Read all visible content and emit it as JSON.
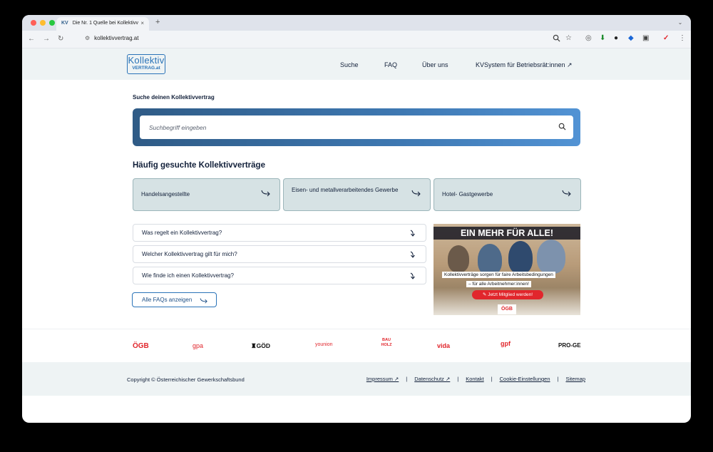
{
  "browser": {
    "tab_badge": "KV",
    "tab_title": "Die Nr. 1 Quelle bei Kollektivv",
    "tab_close": "×",
    "new_tab": "+",
    "url": "kollektivvertrag.at",
    "window_menu": "⌄"
  },
  "header": {
    "logo_line1": "Kollektiv",
    "logo_line2": "VERTRAG.at",
    "nav": [
      "Suche",
      "FAQ",
      "Über uns",
      "KVSystem für Betriebsrät:innen ↗"
    ]
  },
  "search": {
    "label": "Suche deinen Kollektivvertrag",
    "placeholder": "Suchbegriff eingeben"
  },
  "popular": {
    "heading": "Häufig gesuchte Kollektivverträge",
    "cards": [
      "Handelsangestellte",
      "Eisen- und metallverarbeitendes Gewerbe",
      "Hotel- Gastgewerbe"
    ]
  },
  "faq": {
    "items": [
      "Was regelt ein Kollektivvertrag?",
      "Welcher Kollektivvertrag gilt für mich?",
      "Wie finde ich einen Kollektivvertrag?"
    ],
    "all_label": "Alle FAQs anzeigen"
  },
  "banner": {
    "headline": "EIN MEHR FÜR ALLE!",
    "line1": "Kollektivverträge sorgen für faire Arbeitsbedingungen",
    "line2": "– für alle Arbeitnehmer:innen!",
    "cta": "Jetzt Mitglied werden!",
    "logo": "ÖGB"
  },
  "partners": [
    "ÖGB",
    "gpa",
    "GÖD",
    "younion",
    "BAU HOLZ",
    "vida",
    "gpf",
    "PRO-GE"
  ],
  "colors": {
    "ogb_red": "#e1262c",
    "brand_blue": "#2a73b8",
    "navy": "#12203a"
  },
  "footer": {
    "copyright": "Copyright © Österreichischer Gewerkschaftsbund",
    "links": [
      "Impressum ↗",
      "Datenschutz ↗",
      "Kontakt",
      "Cookie-Einstellungen",
      "Sitemap"
    ],
    "separator": "|"
  }
}
